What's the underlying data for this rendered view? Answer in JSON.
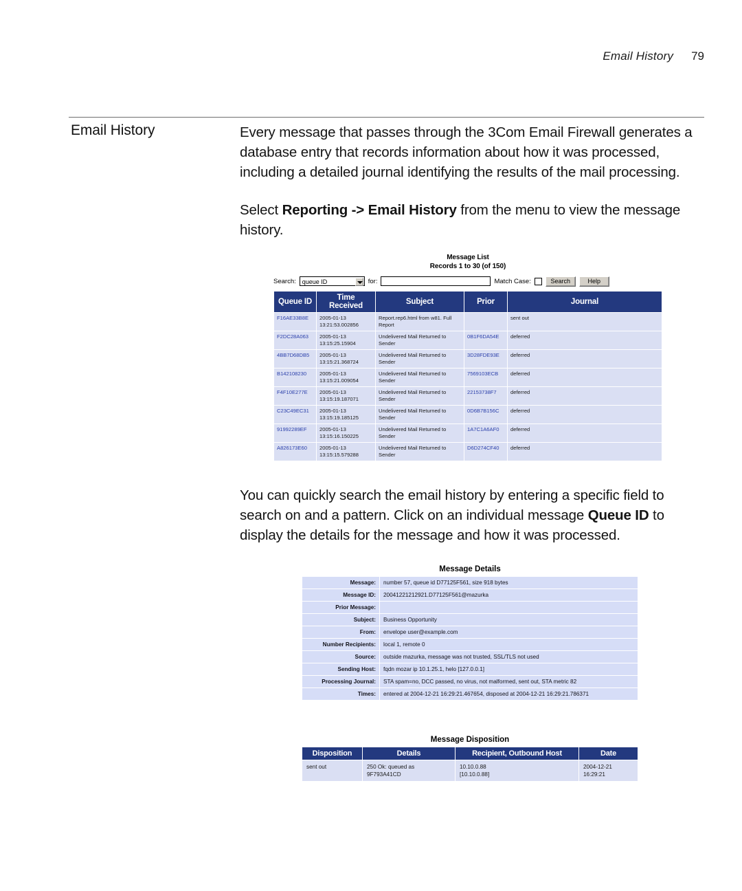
{
  "page_header": {
    "title": "Email History",
    "page_number": "79"
  },
  "section": {
    "heading": "Email History",
    "paragraphs": [
      "Every message that passes through the 3Com Email Firewall generates a database entry that records information about how it was processed, including a detailed journal identifying the results of the mail processing.",
      "Select Reporting -> Email History from the menu to view the message history.",
      "You can quickly search the email history by entering a specific field to search on and a pattern. Click on an individual message Queue ID to display the details for the message and how it was processed."
    ],
    "para2_prefix": "Select ",
    "para2_bold": "Reporting -> Email History",
    "para2_suffix": " from the menu to view the message history.",
    "para3_prefix": "You can quickly search the email history by entering a specific field to search on and a pattern. Click on an individual message ",
    "para3_bold": "Queue ID",
    "para3_suffix": " to display the details for the message and how it was processed."
  },
  "message_list": {
    "title": "Message List",
    "records": "Records 1 to 30 (of 150)",
    "search_label": "Search:",
    "search_field_value": "queue ID",
    "for_label": "for:",
    "for_value": "",
    "for_placeholder": "",
    "match_case_label": "Match Case:",
    "match_case_checked": false,
    "search_button": "Search",
    "help_button": "Help",
    "columns": [
      "Queue ID",
      "Time Received",
      "Subject",
      "Prior",
      "Journal"
    ],
    "rows": [
      {
        "queue_id": "F16AE33B8E",
        "time_received": "2005-01-13 13:21:53.002856",
        "subject": "Report.rep6.html from w81. Full Report",
        "prior": "",
        "journal": "sent out"
      },
      {
        "queue_id": "F2DC28A063",
        "time_received": "2005-01-13 13:15:25.15904",
        "subject": "Undelivered Mail Returned to Sender",
        "prior": "0B1F6DA54E",
        "journal": "deferred"
      },
      {
        "queue_id": "4BB7D68DB5",
        "time_received": "2005-01-13 13:15:21.368724",
        "subject": "Undelivered Mail Returned to Sender",
        "prior": "3D28FDE93E",
        "journal": "deferred"
      },
      {
        "queue_id": "B142108230",
        "time_received": "2005-01-13 13:15:21.009054",
        "subject": "Undelivered Mail Returned to Sender",
        "prior": "7569103ECB",
        "journal": "deferred"
      },
      {
        "queue_id": "F4F10E277E",
        "time_received": "2005-01-13 13:15:19.187071",
        "subject": "Undelivered Mail Returned to Sender",
        "prior": "22153738F7",
        "journal": "deferred"
      },
      {
        "queue_id": "C23C49EC31",
        "time_received": "2005-01-13 13:15:19.185125",
        "subject": "Undelivered Mail Returned to Sender",
        "prior": "0D6B7B156C",
        "journal": "deferred"
      },
      {
        "queue_id": "91992289EF",
        "time_received": "2005-01-13 13:15:16.150225",
        "subject": "Undelivered Mail Returned to Sender",
        "prior": "1A7C1A6AF0",
        "journal": "deferred"
      },
      {
        "queue_id": "A826173E60",
        "time_received": "2005-01-13 13:15:15.579288",
        "subject": "Undelivered Mail Returned to Sender",
        "prior": "D6D274CF40",
        "journal": "deferred"
      }
    ]
  },
  "message_details": {
    "title": "Message Details",
    "fields": [
      {
        "key": "Message:",
        "value": "number 57, queue id D77125F561, size 918 bytes"
      },
      {
        "key": "Message ID:",
        "value": "20041221212921.D77125F561@mazurka"
      },
      {
        "key": "Prior Message:",
        "value": ""
      },
      {
        "key": "Subject:",
        "value": "Business Opportunity"
      },
      {
        "key": "From:",
        "value": "envelope  user@example.com"
      },
      {
        "key": "Number Recipients:",
        "value": "local 1, remote 0"
      },
      {
        "key": "Source:",
        "value": "outside mazurka, message was not trusted, SSL/TLS not used"
      },
      {
        "key": "Sending Host:",
        "value": "fqdn mozar  ip 10.1.25.1, helo [127.0.0.1]"
      },
      {
        "key": "Processing Journal:",
        "value": "STA spam=no, DCC passed, no virus, not malformed, sent out, STA metric 82"
      },
      {
        "key": "Times:",
        "value": "entered at 2004-12-21 16:29:21.467654, disposed at 2004-12-21 16:29:21.786371"
      }
    ]
  },
  "message_disposition": {
    "title": "Message Disposition",
    "columns": [
      "Disposition",
      "Details",
      "Recipient, Outbound Host",
      "Date"
    ],
    "rows": [
      {
        "disposition": "sent out",
        "details": "250 Ok: queued as\n9F793A41CD",
        "recipient": "10.10.0.88\n[10.10.0.88]",
        "date": "2004-12-21\n16:29:21"
      }
    ]
  },
  "colors": {
    "table_header": "#23397f",
    "table_row": "#dadff3",
    "detail_row": "#d6ddf7",
    "link": "#2a3faa"
  }
}
